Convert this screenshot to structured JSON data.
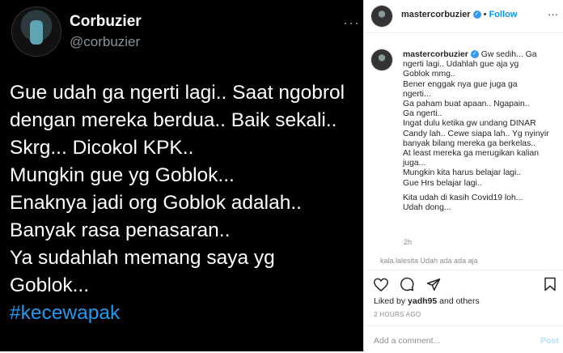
{
  "tweet": {
    "name": "Corbuzier",
    "handle": "@corbuzier",
    "more": "···",
    "lines": [
      "Gue udah ga ngerti lagi.. Saat ngobrol",
      "dengan mereka berdua.. Baik sekali..",
      "Skrg... Dicokol KPK..",
      "Mungkin gue yg Goblok...",
      "Enaknya jadi org Goblok adalah..",
      "Banyak rasa penasaran..",
      "Ya sudahlah memang saya yg",
      "Goblok..."
    ],
    "hashtag": "#kecewapak"
  },
  "instagram": {
    "header": {
      "username": "mastercorbuzier",
      "verified_mark": "✓",
      "separator": "•",
      "follow_label": "Follow",
      "more": "···"
    },
    "caption": {
      "username": "mastercorbuzier",
      "verified_mark": "✓",
      "lines": [
        "Gw sedih... Ga",
        "ngerti lagi.. Udahlah gue aja yg",
        "Goblok mmg..",
        "Bener enggak nya gue juga ga",
        "ngerti...",
        "Ga paham buat apaan.. Ngapain..",
        "Ga ngerti..",
        "Ingat dulu ketika gw undang DINAR",
        "Candy lah.. Cewe siapa lah.. Yg nyinyir",
        "banyak bilang mereka ga berkelas..",
        "At least mereka ga merugikan kalian",
        "juga...",
        "Mungkin kita harus belajar lagi..",
        "Gue Hrs belajar lagi..",
        "Kita udah di kasih Covid19 loh...",
        "Udah dong..."
      ],
      "time": "2h"
    },
    "partial_comment": "kala.lalesita  Udah ada ada aja",
    "likes_prefix": "Liked by ",
    "likes_user": "yadh95",
    "likes_suffix": " and others",
    "time_ago": "2 HOURS AGO",
    "comment_placeholder": "Add a comment...",
    "post_label": "Post",
    "icons": [
      "heart-icon",
      "comment-icon",
      "share-icon",
      "bookmark-icon"
    ],
    "colors": {
      "accent": "#0095f6",
      "verified": "#3897f0",
      "hashtag": "#1d9bf0"
    }
  }
}
